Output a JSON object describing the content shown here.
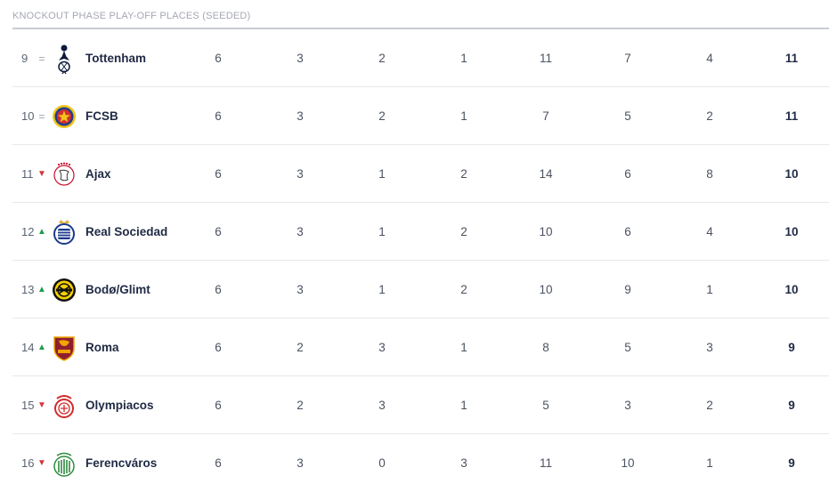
{
  "section_title": "KNOCKOUT PHASE PLAY-OFF PLACES (SEEDED)",
  "rows": [
    {
      "pos": "9",
      "trend": "same",
      "trend_symbol": "=",
      "team": "Tottenham",
      "logo_icon": "tottenham-crest-icon",
      "played": "6",
      "won": "3",
      "drawn": "2",
      "lost": "1",
      "gf": "11",
      "ga": "7",
      "gd": "4",
      "pts": "11"
    },
    {
      "pos": "10",
      "trend": "same",
      "trend_symbol": "=",
      "team": "FCSB",
      "logo_icon": "fcsb-crest-icon",
      "played": "6",
      "won": "3",
      "drawn": "2",
      "lost": "1",
      "gf": "7",
      "ga": "5",
      "gd": "2",
      "pts": "11"
    },
    {
      "pos": "11",
      "trend": "down",
      "trend_symbol": "▼",
      "team": "Ajax",
      "logo_icon": "ajax-crest-icon",
      "played": "6",
      "won": "3",
      "drawn": "1",
      "lost": "2",
      "gf": "14",
      "ga": "6",
      "gd": "8",
      "pts": "10"
    },
    {
      "pos": "12",
      "trend": "up",
      "trend_symbol": "▲",
      "team": "Real Sociedad",
      "logo_icon": "real-sociedad-crest-icon",
      "played": "6",
      "won": "3",
      "drawn": "1",
      "lost": "2",
      "gf": "10",
      "ga": "6",
      "gd": "4",
      "pts": "10"
    },
    {
      "pos": "13",
      "trend": "up",
      "trend_symbol": "▲",
      "team": "Bodø/Glimt",
      "logo_icon": "bodo-glimt-crest-icon",
      "played": "6",
      "won": "3",
      "drawn": "1",
      "lost": "2",
      "gf": "10",
      "ga": "9",
      "gd": "1",
      "pts": "10"
    },
    {
      "pos": "14",
      "trend": "up",
      "trend_symbol": "▲",
      "team": "Roma",
      "logo_icon": "roma-crest-icon",
      "played": "6",
      "won": "2",
      "drawn": "3",
      "lost": "1",
      "gf": "8",
      "ga": "5",
      "gd": "3",
      "pts": "9"
    },
    {
      "pos": "15",
      "trend": "down",
      "trend_symbol": "▼",
      "team": "Olympiacos",
      "logo_icon": "olympiacos-crest-icon",
      "played": "6",
      "won": "2",
      "drawn": "3",
      "lost": "1",
      "gf": "5",
      "ga": "3",
      "gd": "2",
      "pts": "9"
    },
    {
      "pos": "16",
      "trend": "down",
      "trend_symbol": "▼",
      "team": "Ferencváros",
      "logo_icon": "ferencvaros-crest-icon",
      "played": "6",
      "won": "3",
      "drawn": "0",
      "lost": "3",
      "gf": "11",
      "ga": "10",
      "gd": "1",
      "pts": "9"
    }
  ],
  "colors": {
    "up": "#1f9d4c",
    "down": "#d6343c",
    "same": "#a0a6b0",
    "text": "#1f2a44",
    "divider": "#e6e8ec"
  }
}
